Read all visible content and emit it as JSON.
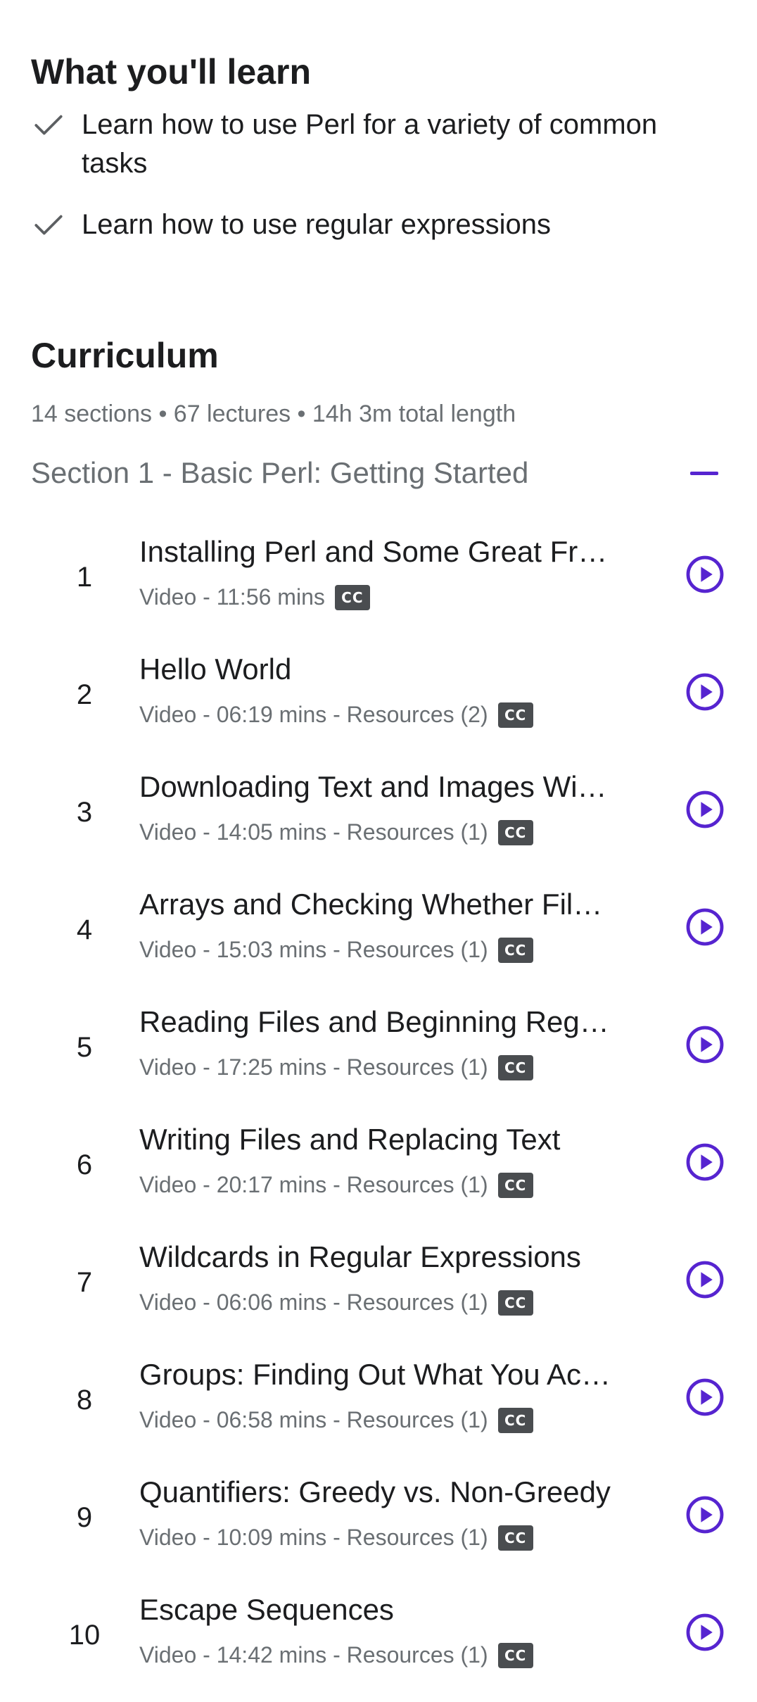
{
  "learn": {
    "heading": "What you'll learn",
    "items": [
      "Learn how to use Perl for a variety of common tasks",
      "Learn how to use regular expressions"
    ]
  },
  "curriculum": {
    "heading": "Curriculum",
    "meta": "14 sections • 67 lectures • 14h 3m total length",
    "section_title": "Section 1 - Basic Perl: Getting Started",
    "cc_label": "CC",
    "lectures": [
      {
        "num": "1",
        "title": "Installing Perl and Some Great Fr…",
        "meta": "Video - 11:56 mins"
      },
      {
        "num": "2",
        "title": "Hello World",
        "meta": "Video - 06:19 mins - Resources (2)"
      },
      {
        "num": "3",
        "title": "Downloading Text and Images Wi…",
        "meta": "Video - 14:05 mins - Resources (1)"
      },
      {
        "num": "4",
        "title": "Arrays and Checking Whether Fil…",
        "meta": "Video - 15:03 mins - Resources (1)"
      },
      {
        "num": "5",
        "title": "Reading Files and Beginning Reg…",
        "meta": "Video - 17:25 mins - Resources (1)"
      },
      {
        "num": "6",
        "title": "Writing Files and Replacing Text",
        "meta": "Video - 20:17 mins - Resources (1)"
      },
      {
        "num": "7",
        "title": "Wildcards in Regular Expressions",
        "meta": "Video - 06:06 mins - Resources (1)"
      },
      {
        "num": "8",
        "title": "Groups: Finding Out What You Ac…",
        "meta": "Video - 06:58 mins - Resources (1)"
      },
      {
        "num": "9",
        "title": "Quantifiers: Greedy vs. Non-Greedy",
        "meta": "Video - 10:09 mins - Resources (1)"
      },
      {
        "num": "10",
        "title": "Escape Sequences",
        "meta": "Video - 14:42 mins - Resources (1)"
      }
    ]
  },
  "icons": {
    "check": "check-icon",
    "collapse": "minus-icon",
    "play": "play-circle-icon",
    "cc": "closed-captions-icon"
  },
  "colors": {
    "accent": "#5624d0",
    "text": "#1c1d1f",
    "muted": "#6a6f73",
    "cc_badge": "#4a4d50"
  }
}
